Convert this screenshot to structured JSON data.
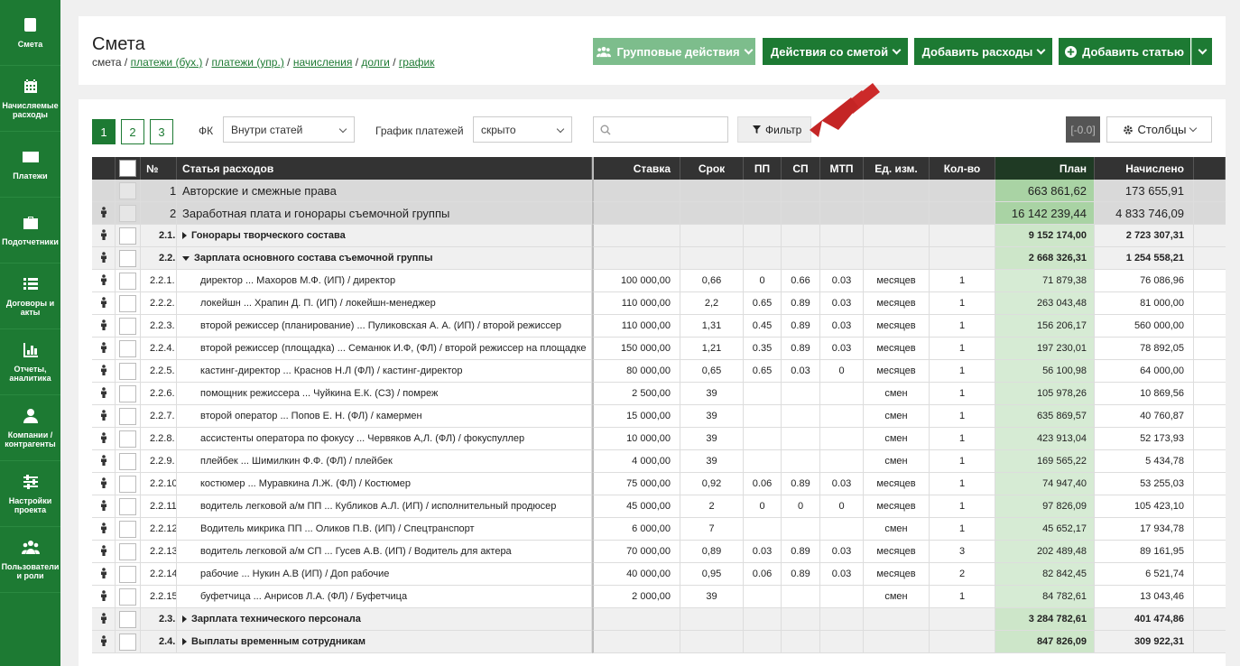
{
  "sidebar": {
    "items": [
      {
        "label": "Смета",
        "icon": "book-icon"
      },
      {
        "label": "Начисляемые расходы",
        "icon": "calendar-icon"
      },
      {
        "label": "Платежи",
        "icon": "card-icon"
      },
      {
        "label": "Подотчетники",
        "icon": "briefcase-icon"
      },
      {
        "label": "Договоры и акты",
        "icon": "list-icon"
      },
      {
        "label": "Отчеты, аналитика",
        "icon": "bar-chart-icon"
      },
      {
        "label": "Компании / контрагенты",
        "icon": "user-icon"
      },
      {
        "label": "Настройки проекта",
        "icon": "sliders-icon"
      },
      {
        "label": "Пользователи и роли",
        "icon": "users-icon"
      }
    ]
  },
  "header": {
    "title": "Смета",
    "breadcrumb": {
      "current": "смета",
      "sep": "/",
      "links": [
        "платежи (бух.)",
        "платежи (упр.)",
        "начисления",
        "долги",
        "график"
      ]
    },
    "buttons": {
      "group": "Групповые действия",
      "estimate": "Действия со сметой",
      "add_expenses": "Добавить расходы",
      "add_item": "Добавить статью"
    }
  },
  "toolbar": {
    "pages": [
      "1",
      "2",
      "3"
    ],
    "fk_label": "ФК",
    "fk_value": "Внутри статей",
    "schedule_label": "График платежей",
    "schedule_value": "скрыто",
    "search_placeholder": "",
    "filter_label": "Фильтр",
    "badge": "[-0.0]",
    "columns_label": "Столбцы"
  },
  "table": {
    "headers": {
      "num": "№",
      "name": "Статья расходов",
      "rate": "Ставка",
      "term": "Срок",
      "pp": "ПП",
      "sp": "СП",
      "mtp": "МТП",
      "unit": "Ед. изм.",
      "qty": "Кол-во",
      "plan": "План",
      "accrued": "Начислено"
    },
    "rows": [
      {
        "level": 1,
        "num": "1.",
        "name": "Авторские и смежные права",
        "rate": "",
        "term": "",
        "pp": "",
        "sp": "",
        "mtp": "",
        "unit": "",
        "qty": "",
        "plan": "663 861,62",
        "accrued": "173 655,91"
      },
      {
        "level": 1,
        "num": "2.",
        "name": "Заработная плата и гонорары съемочной группы",
        "rate": "",
        "term": "",
        "pp": "",
        "sp": "",
        "mtp": "",
        "unit": "",
        "qty": "",
        "plan": "16 142 239,44",
        "accrued": "4 833 746,09"
      },
      {
        "level": 2,
        "num": "2.1.",
        "name": "Гонорары творческого состава",
        "arrow": "right",
        "rate": "",
        "term": "",
        "pp": "",
        "sp": "",
        "mtp": "",
        "unit": "",
        "qty": "",
        "plan": "9 152 174,00",
        "accrued": "2 723 307,31"
      },
      {
        "level": 2,
        "num": "2.2.",
        "name": "Зарплата основного состава съемочной группы",
        "arrow": "down",
        "rate": "",
        "term": "",
        "pp": "",
        "sp": "",
        "mtp": "",
        "unit": "",
        "qty": "",
        "plan": "2 668 326,31",
        "accrued": "1 254 558,21"
      },
      {
        "level": 3,
        "num": "2.2.1.",
        "name": "директор ... Махоров М.Ф. (ИП) / директор",
        "rate": "100 000,00",
        "term": "0,66",
        "pp": "0",
        "sp": "0.66",
        "mtp": "0.03",
        "unit": "месяцев",
        "qty": "1",
        "plan": "71 879,38",
        "accrued": "76 086,96"
      },
      {
        "level": 3,
        "num": "2.2.2.",
        "name": "локейшн ... Храпин Д. П. (ИП) / локейшн-менеджер",
        "rate": "110 000,00",
        "term": "2,2",
        "pp": "0.65",
        "sp": "0.89",
        "mtp": "0.03",
        "unit": "месяцев",
        "qty": "1",
        "plan": "263 043,48",
        "accrued": "81 000,00"
      },
      {
        "level": 3,
        "num": "2.2.3.",
        "name": "второй режиссер (планирование) ... Пуликовская А. А. (ИП) / второй режиссер",
        "rate": "110 000,00",
        "term": "1,31",
        "pp": "0.45",
        "sp": "0.89",
        "mtp": "0.03",
        "unit": "месяцев",
        "qty": "1",
        "plan": "156 206,17",
        "accrued": "560 000,00"
      },
      {
        "level": 3,
        "num": "2.2.4.",
        "name": "второй режиссер (площадка) ... Семанюк И.Ф, (ФЛ) / второй режиссер на площадке",
        "rate": "150 000,00",
        "term": "1,21",
        "pp": "0.35",
        "sp": "0.89",
        "mtp": "0.03",
        "unit": "месяцев",
        "qty": "1",
        "plan": "197 230,01",
        "accrued": "78 892,05"
      },
      {
        "level": 3,
        "num": "2.2.5.",
        "name": "кастинг-директор ... Краснов Н.Л (ФЛ) / кастинг-директор",
        "rate": "80 000,00",
        "term": "0,65",
        "pp": "0.65",
        "sp": "0.03",
        "mtp": "0",
        "unit": "месяцев",
        "qty": "1",
        "plan": "56 100,98",
        "accrued": "64 000,00"
      },
      {
        "level": 3,
        "num": "2.2.6.",
        "name": "помощник режиссера ... Чуйкина Е.К. (СЗ) / помреж",
        "rate": "2 500,00",
        "term": "39",
        "pp": "",
        "sp": "",
        "mtp": "",
        "unit": "смен",
        "qty": "1",
        "plan": "105 978,26",
        "accrued": "10 869,56"
      },
      {
        "level": 3,
        "num": "2.2.7.",
        "name": "второй оператор ... Попов Е. Н. (ФЛ) / камермен",
        "rate": "15 000,00",
        "term": "39",
        "pp": "",
        "sp": "",
        "mtp": "",
        "unit": "смен",
        "qty": "1",
        "plan": "635 869,57",
        "accrued": "40 760,87"
      },
      {
        "level": 3,
        "num": "2.2.8.",
        "name": "ассистенты оператора по фокусу ... Червяков А,Л. (ФЛ) / фокуспуллер",
        "rate": "10 000,00",
        "term": "39",
        "pp": "",
        "sp": "",
        "mtp": "",
        "unit": "смен",
        "qty": "1",
        "plan": "423 913,04",
        "accrued": "52 173,93"
      },
      {
        "level": 3,
        "num": "2.2.9.",
        "name": "плейбек ... Шимилкин Ф.Ф. (ФЛ) / плейбек",
        "rate": "4 000,00",
        "term": "39",
        "pp": "",
        "sp": "",
        "mtp": "",
        "unit": "смен",
        "qty": "1",
        "plan": "169 565,22",
        "accrued": "5 434,78"
      },
      {
        "level": 3,
        "num": "2.2.10.",
        "name": "костюмер ... Муравкина Л.Ж. (ФЛ) / Костюмер",
        "rate": "75 000,00",
        "term": "0,92",
        "pp": "0.06",
        "sp": "0.89",
        "mtp": "0.03",
        "unit": "месяцев",
        "qty": "1",
        "plan": "74 947,40",
        "accrued": "53 255,03"
      },
      {
        "level": 3,
        "num": "2.2.11.",
        "name": "водитель легковой а/м ПП ... Кубликов А.Л. (ИП) / исполнительный продюсер",
        "rate": "45 000,00",
        "term": "2",
        "pp": "0",
        "sp": "0",
        "mtp": "0",
        "unit": "месяцев",
        "qty": "1",
        "plan": "97 826,09",
        "accrued": "105 423,10"
      },
      {
        "level": 3,
        "num": "2.2.12.",
        "name": "Водитель микрика ПП ... Оликов П.В. (ИП) / Спецтранспорт",
        "rate": "6 000,00",
        "term": "7",
        "pp": "",
        "sp": "",
        "mtp": "",
        "unit": "смен",
        "qty": "1",
        "plan": "45 652,17",
        "accrued": "17 934,78"
      },
      {
        "level": 3,
        "num": "2.2.13.",
        "name": "водитель легковой а/м СП ... Гусев А.В. (ИП) / Водитель для актера",
        "rate": "70 000,00",
        "term": "0,89",
        "pp": "0.03",
        "sp": "0.89",
        "mtp": "0.03",
        "unit": "месяцев",
        "qty": "3",
        "plan": "202 489,48",
        "accrued": "89 161,95"
      },
      {
        "level": 3,
        "num": "2.2.14.",
        "name": "рабочие ... Нукин А.В (ИП) / Доп рабочие",
        "rate": "40 000,00",
        "term": "0,95",
        "pp": "0.06",
        "sp": "0.89",
        "mtp": "0.03",
        "unit": "месяцев",
        "qty": "2",
        "plan": "82 842,45",
        "accrued": "6 521,74"
      },
      {
        "level": 3,
        "num": "2.2.15.",
        "name": "буфетчица ... Анрисов Л.А. (ФЛ) / Буфетчица",
        "rate": "2 000,00",
        "term": "39",
        "pp": "",
        "sp": "",
        "mtp": "",
        "unit": "смен",
        "qty": "1",
        "plan": "84 782,61",
        "accrued": "13 043,46"
      },
      {
        "level": 2,
        "num": "2.3.",
        "name": "Зарплата технического персонала",
        "arrow": "right",
        "rate": "",
        "term": "",
        "pp": "",
        "sp": "",
        "mtp": "",
        "unit": "",
        "qty": "",
        "plan": "3 284 782,61",
        "accrued": "401 474,86"
      },
      {
        "level": 2,
        "num": "2.4.",
        "name": "Выплаты временным сотрудникам",
        "arrow": "right",
        "rate": "",
        "term": "",
        "pp": "",
        "sp": "",
        "mtp": "",
        "unit": "",
        "qty": "",
        "plan": "847 826,09",
        "accrued": "309 922,31"
      }
    ]
  }
}
